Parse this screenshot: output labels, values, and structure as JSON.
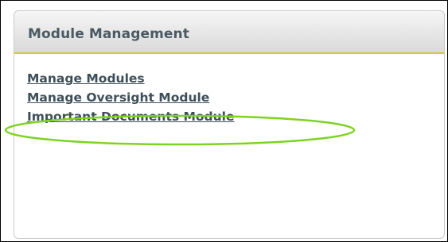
{
  "panel": {
    "title": "Module Management"
  },
  "links": [
    {
      "label": "Manage Modules"
    },
    {
      "label": "Manage Oversight Module"
    },
    {
      "label": "Important Documents Module"
    }
  ],
  "annotation": {
    "color": "#7ed321"
  }
}
